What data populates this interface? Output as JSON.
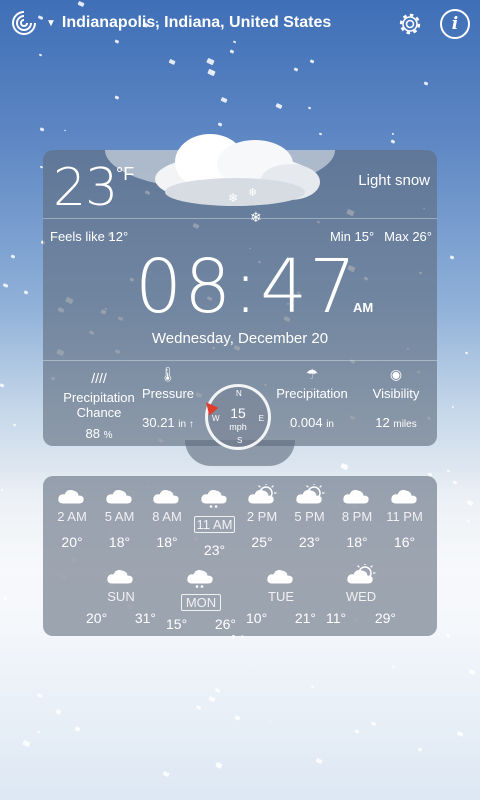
{
  "header": {
    "location": "Indianapolis, Indiana, United States",
    "icons": [
      "app-logo-icon",
      "gear-icon",
      "info-icon"
    ]
  },
  "current": {
    "temperature": "23",
    "unit": "°F",
    "condition": "Light snow",
    "feels_like": "Feels like 12°",
    "min": "Min 15°",
    "max": "Max 26°",
    "time": "08:47",
    "ampm": "AM",
    "date": "Wednesday, December 20"
  },
  "stats": {
    "precip_chance": {
      "label": "Precipitation Chance",
      "value": "88",
      "unit": "%"
    },
    "pressure": {
      "label": "Pressure",
      "value": "30.21",
      "unit": "in ↑"
    },
    "wind": {
      "speed": "15",
      "unit": "mph",
      "n": "N",
      "e": "E",
      "s": "S",
      "w": "W"
    },
    "precipitation": {
      "label": "Precipitation",
      "value": "0.004",
      "unit": "in"
    },
    "visibility": {
      "label": "Visibility",
      "value": "12",
      "unit": "miles"
    }
  },
  "hourly": [
    {
      "time": "2 AM",
      "temp": "20°",
      "icon": "cloudy-icon"
    },
    {
      "time": "5 AM",
      "temp": "18°",
      "icon": "cloudy-icon"
    },
    {
      "time": "8 AM",
      "temp": "18°",
      "icon": "cloudy-icon"
    },
    {
      "time": "11 AM",
      "temp": "23°",
      "icon": "snow-cloud-icon",
      "selected": true
    },
    {
      "time": "2 PM",
      "temp": "25°",
      "icon": "partly-sunny-icon"
    },
    {
      "time": "5 PM",
      "temp": "23°",
      "icon": "partly-sunny-icon"
    },
    {
      "time": "8 PM",
      "temp": "18°",
      "icon": "cloudy-icon"
    },
    {
      "time": "11 PM",
      "temp": "16°",
      "icon": "cloudy-icon"
    }
  ],
  "daily": [
    {
      "day": "SUN",
      "lo": "20°",
      "hi": "31°",
      "icon": "cloudy-icon"
    },
    {
      "day": "MON",
      "lo": "15°",
      "hi": "26°",
      "icon": "snow-cloud-icon",
      "selected": true
    },
    {
      "day": "TUE",
      "lo": "10°",
      "hi": "21°",
      "icon": "cloudy-icon"
    },
    {
      "day": "WED",
      "lo": "11°",
      "hi": "29°",
      "icon": "partly-sunny-icon"
    }
  ]
}
